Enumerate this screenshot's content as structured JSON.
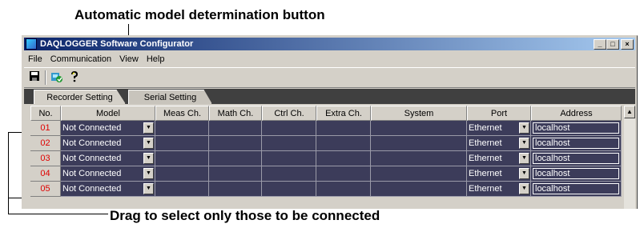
{
  "annotations": {
    "top": "Automatic model determination button",
    "bottom": "Drag to select only those to be connected"
  },
  "window": {
    "title": "DAQLOGGER Software Configurator",
    "controls": [
      "_",
      "□",
      "×"
    ]
  },
  "menu": [
    "File",
    "Communication",
    "View",
    "Help"
  ],
  "toolbar": {
    "save_icon": "save-icon",
    "auto_model_icon": "auto-model-icon",
    "help_icon": "help-icon"
  },
  "tabs": [
    {
      "label": "Recorder Setting",
      "active": true
    },
    {
      "label": "Serial Setting",
      "active": false
    }
  ],
  "table": {
    "headers": [
      "No.",
      "Model",
      "Meas Ch.",
      "Math Ch.",
      "Ctrl Ch.",
      "Extra Ch.",
      "System",
      "Port",
      "Address"
    ],
    "rows": [
      {
        "no": "01",
        "model": "Not Connected",
        "port": "Ethernet",
        "address": "localhost"
      },
      {
        "no": "02",
        "model": "Not Connected",
        "port": "Ethernet",
        "address": "localhost"
      },
      {
        "no": "03",
        "model": "Not Connected",
        "port": "Ethernet",
        "address": "localhost"
      },
      {
        "no": "04",
        "model": "Not Connected",
        "port": "Ethernet",
        "address": "localhost"
      },
      {
        "no": "05",
        "model": "Not Connected",
        "port": "Ethernet",
        "address": "localhost"
      }
    ]
  },
  "colors": {
    "cell_bg": "#3c3c5a",
    "row_number": "#e00000",
    "titlebar_start": "#0a246a",
    "titlebar_end": "#a6caf0"
  }
}
